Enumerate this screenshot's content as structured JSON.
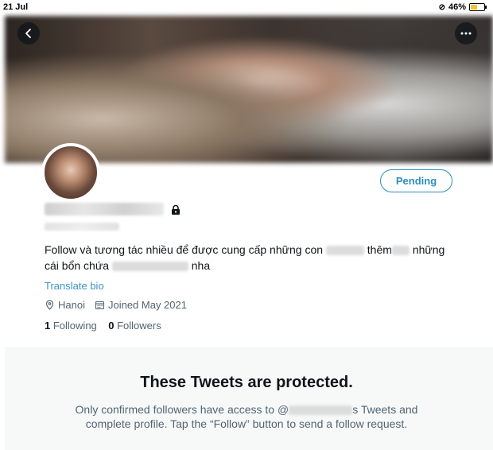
{
  "status_bar": {
    "time": "21 Jul",
    "battery": "46%",
    "battery_level": 0.46
  },
  "profile": {
    "follow_state_button": "Pending",
    "bio": {
      "part1": "Follow và tương tác nhiều để được cung cấp những con",
      "part2": "thêm",
      "part3": "những",
      "part4": "cái bổn chứa",
      "part5": "nha"
    },
    "translate_link": "Translate bio",
    "location": "Hanoi",
    "joined": "Joined May 2021",
    "following_count": "1",
    "following_label": "Following",
    "followers_count": "0",
    "followers_label": "Followers"
  },
  "protected": {
    "title": "These Tweets are protected.",
    "line1_start": "Only confirmed followers have access to @",
    "line1_end": "s Tweets and",
    "line2": "complete profile. Tap the “Follow” button to send a follow request."
  },
  "icons": {
    "back": "chevron-left-icon",
    "more": "more-dots-icon",
    "lock": "lock-icon",
    "location": "location-pin-icon",
    "calendar": "calendar-icon",
    "link": "link-icon"
  }
}
